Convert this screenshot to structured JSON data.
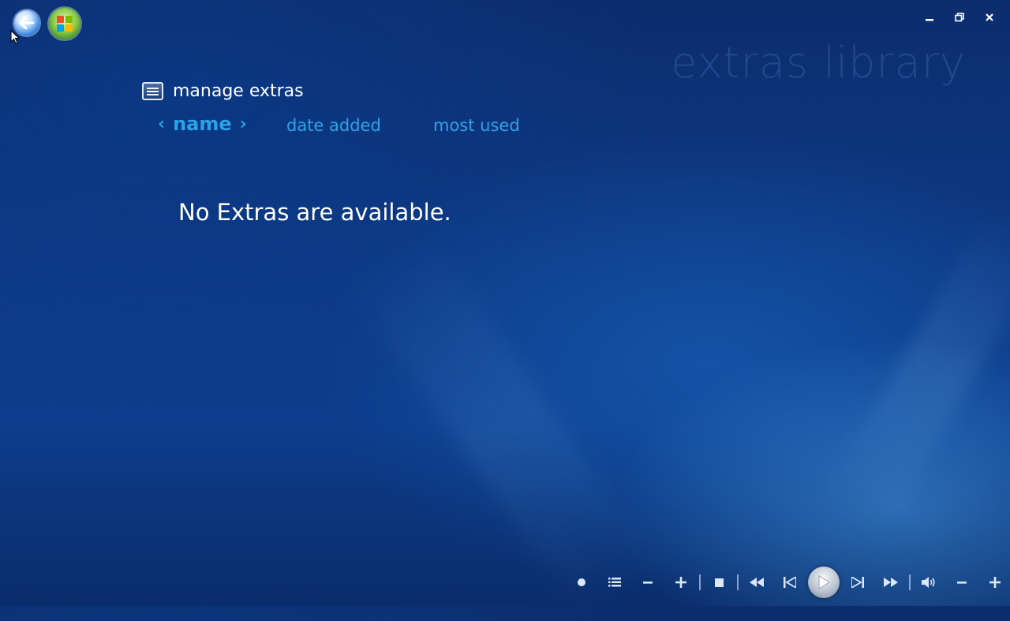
{
  "watermark": "extras library",
  "header": {
    "manage_label": "manage extras"
  },
  "sort": {
    "active_label": "name",
    "options": [
      "date added",
      "most used"
    ]
  },
  "main": {
    "empty_message": "No Extras are available."
  },
  "icons": {
    "back": "back-arrow-icon",
    "start": "windows-start-orb-icon",
    "minimize": "minimize-icon",
    "restore": "restore-icon",
    "close": "close-icon",
    "record": "record-icon",
    "guide": "guide-list-icon",
    "channel_down": "channel-down-icon",
    "channel_up": "channel-up-icon",
    "stop": "stop-icon",
    "rewind": "rewind-icon",
    "previous": "skip-back-icon",
    "play": "play-icon",
    "next": "skip-forward-icon",
    "fast_forward": "fast-forward-icon",
    "mute": "volume-icon",
    "volume_down": "volume-down-icon",
    "volume_up": "volume-up-icon"
  },
  "colors": {
    "accent": "#2aa1e8",
    "background": "#0d3a86"
  }
}
